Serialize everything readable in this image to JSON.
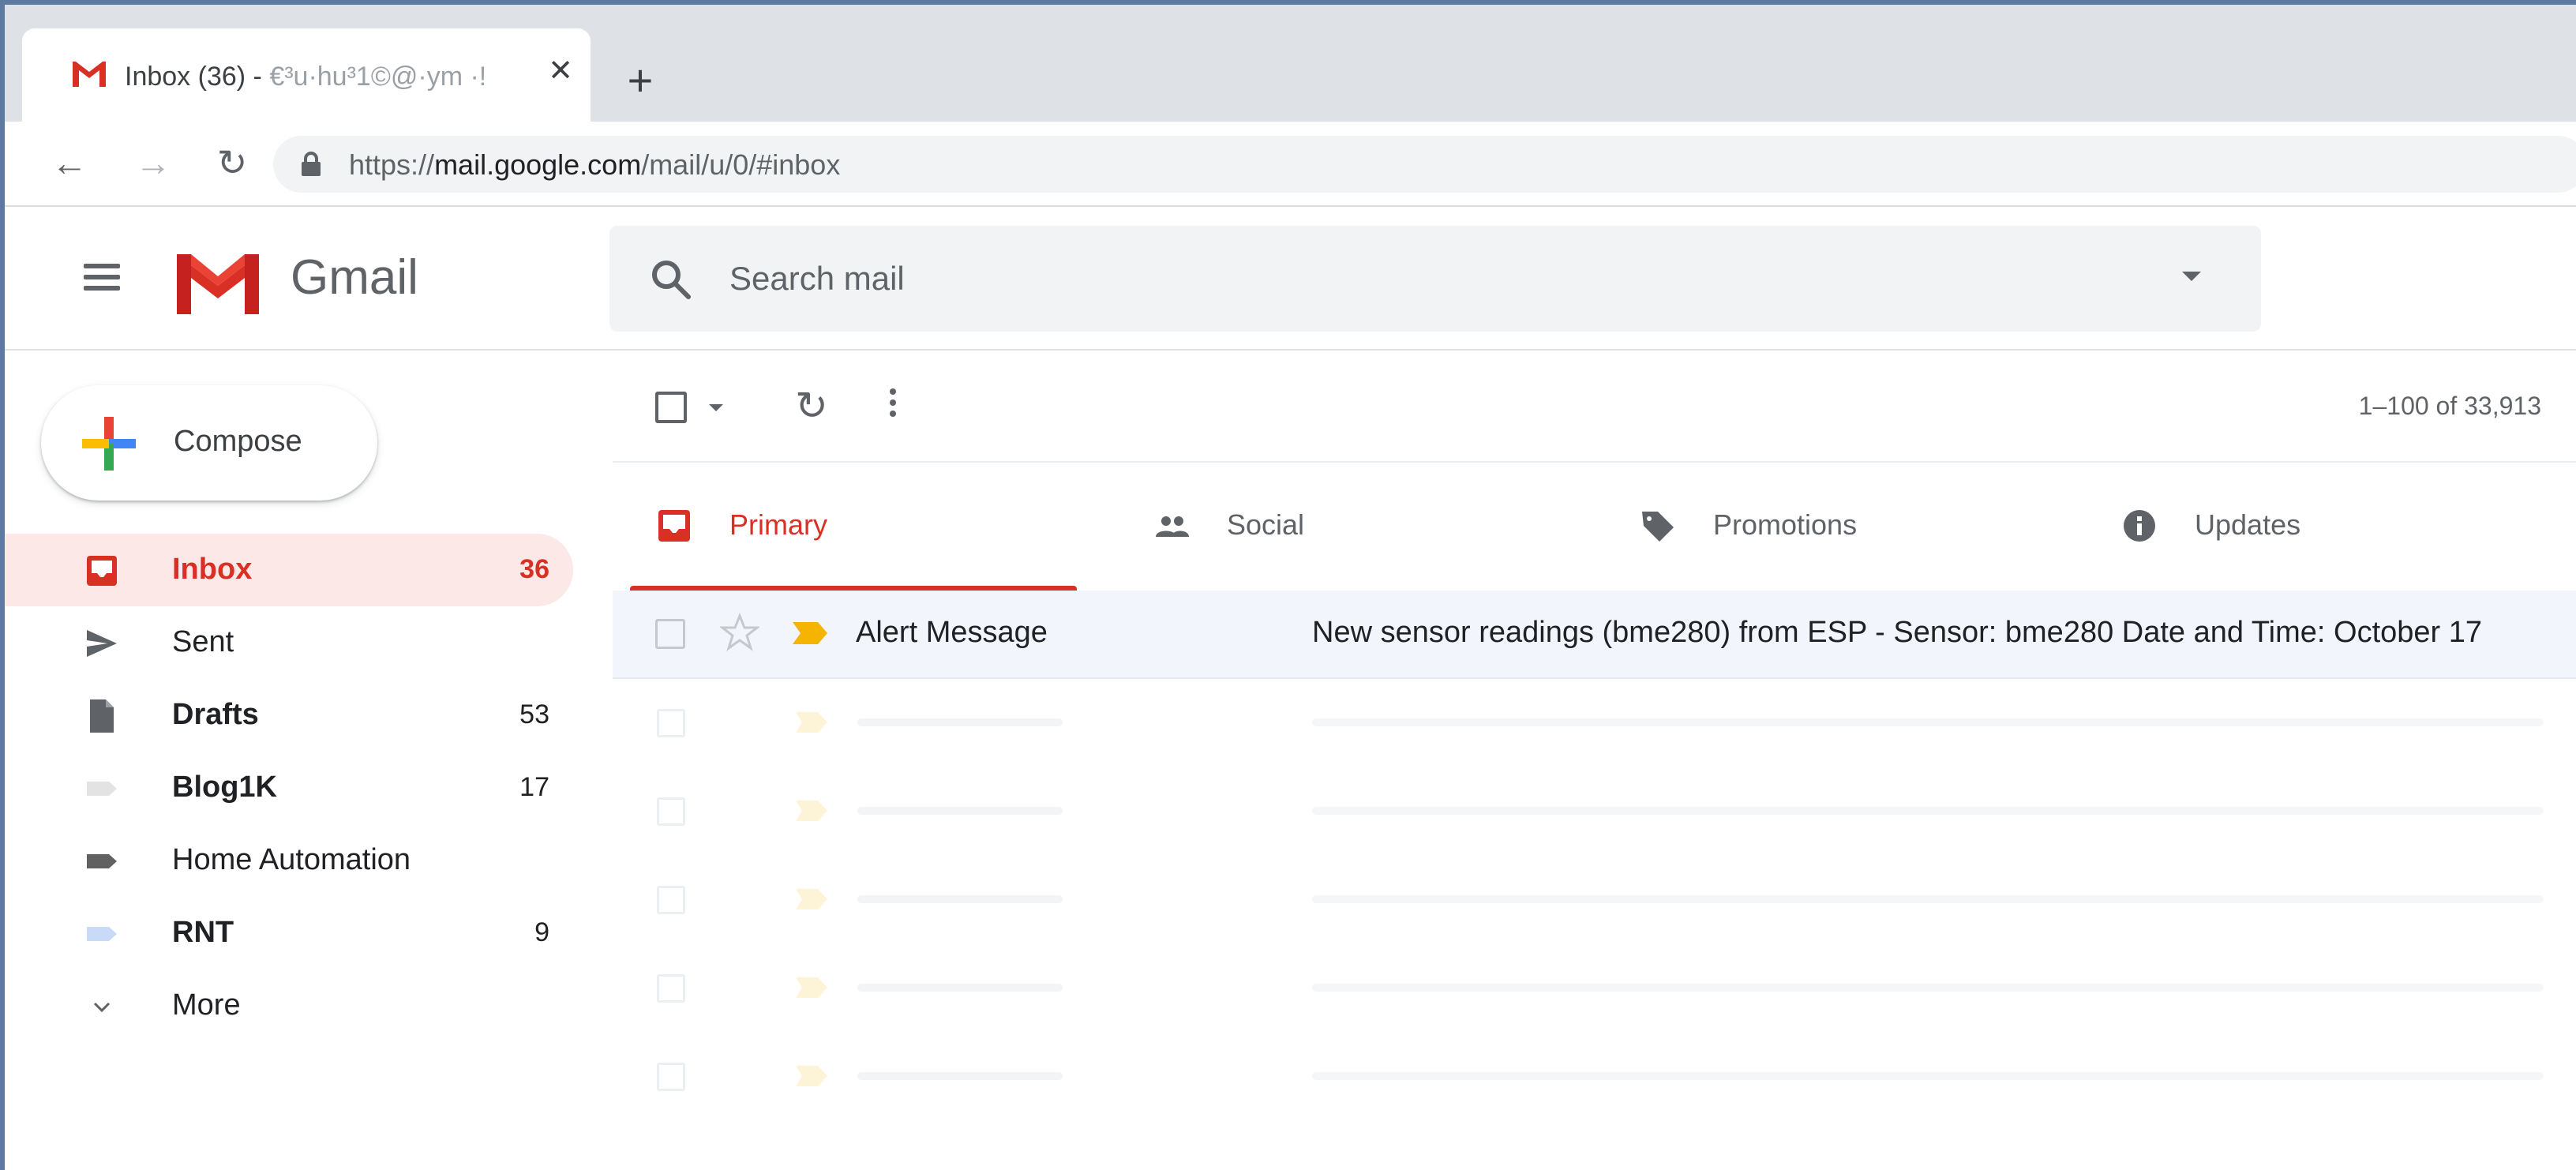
{
  "browser": {
    "tab_title": "Inbox (36) - ",
    "tab_title_obscured": "€³u·hu³1©@·ym ·!",
    "tab_close": "✕",
    "new_tab": "+",
    "url_scheme": "https://",
    "url_host": "mail.google.com",
    "url_path": "/mail/u/0/#inbox"
  },
  "header": {
    "product_name": "Gmail",
    "search_placeholder": "Search mail"
  },
  "sidebar": {
    "compose_label": "Compose",
    "items": [
      {
        "label": "Inbox",
        "count": "36",
        "icon": "inbox-icon",
        "active": true,
        "bold": true
      },
      {
        "label": "Sent",
        "count": "",
        "icon": "send-icon",
        "active": false,
        "bold": false
      },
      {
        "label": "Drafts",
        "count": "53",
        "icon": "draft-icon",
        "active": false,
        "bold": true
      },
      {
        "label": "Blog1K",
        "count": "17",
        "icon": "label-icon",
        "active": false,
        "bold": true
      },
      {
        "label": "Home Automation",
        "count": "",
        "icon": "label-icon",
        "active": false,
        "bold": false
      },
      {
        "label": "RNT",
        "count": "9",
        "icon": "label-icon",
        "active": false,
        "bold": true
      },
      {
        "label": "More",
        "count": "",
        "icon": "chevron-down-icon",
        "active": false,
        "bold": false
      }
    ],
    "label_colors": {
      "blog1k": "#e3e3e3",
      "home_automation": "#616161",
      "rnt": "#c9daf8"
    }
  },
  "toolbar": {
    "pager_text": "1–100 of 33,913"
  },
  "categories": {
    "tabs": [
      {
        "label": "Primary",
        "icon": "inbox-icon",
        "active": true
      },
      {
        "label": "Social",
        "icon": "people-icon",
        "active": false
      },
      {
        "label": "Promotions",
        "icon": "tag-icon",
        "active": false
      },
      {
        "label": "Updates",
        "icon": "info-icon",
        "active": false
      }
    ]
  },
  "emails": [
    {
      "sender": "Alert Message",
      "subject": "New sensor readings (bme280) from ESP - Sensor: bme280 Date and Time: October 17",
      "important": true,
      "starred": false
    }
  ],
  "colors": {
    "accent": "#d93025",
    "important_marker": "#f4b400",
    "selected_row": "#f2f6fc"
  }
}
